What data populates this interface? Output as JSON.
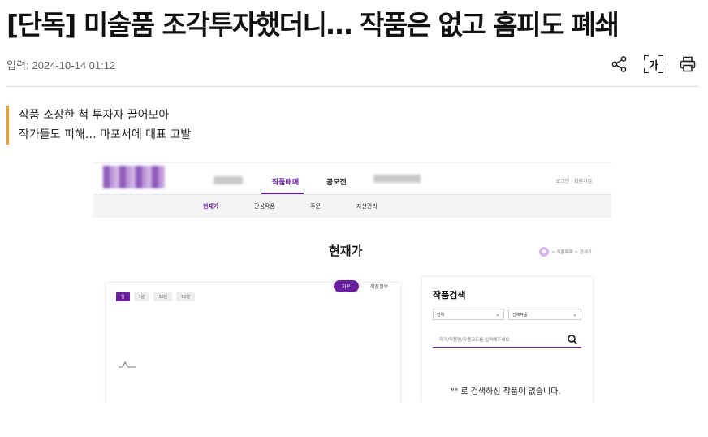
{
  "article": {
    "headline": "[단독] 미술품 조각투자했더니… 작품은 없고 홈피도 폐쇄",
    "date_label": "입력:",
    "date_value": "2024-10-14 01:12",
    "subtitle_lines": [
      "작품 소장한 척 투자자 끌어모아",
      "작가들도 피해… 마포서에 대표 고발"
    ]
  },
  "toolbar": {
    "share_icon": "share-icon",
    "font_size_label": "가",
    "print_icon": "print-icon"
  },
  "embedded_screenshot": {
    "nav": [
      "작품매매",
      "공모전"
    ],
    "header_links": "로그인 · 회원가입",
    "subnav": [
      "현재가",
      "관심작품",
      "주문",
      "자산관리"
    ],
    "page_title": "현재가",
    "breadcrumb": "> 작품매매 > 현재가",
    "tabs": [
      "차트",
      "작품정보"
    ],
    "periods": [
      "일",
      "1분",
      "30분",
      "60분"
    ],
    "search_title": "작품검색",
    "select_1": "전체",
    "select_2": "전체작품",
    "search_placeholder": "작가/작품명/작품코드를 입력해주세요.",
    "empty_message": "\"\" 로 검색하신 작품이 없습니다."
  },
  "colors": {
    "accent": "#6a1ea0",
    "quote_bar": "#f0a030"
  }
}
